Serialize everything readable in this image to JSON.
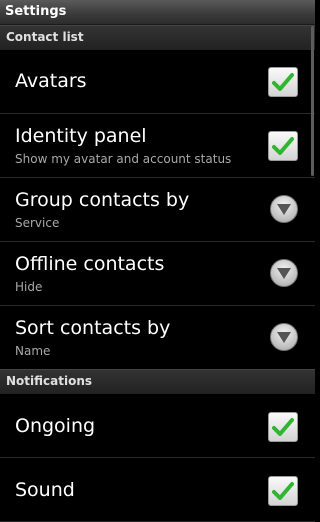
{
  "window": {
    "title": "Settings"
  },
  "sections": {
    "contact_list": "Contact list",
    "notifications": "Notifications"
  },
  "settings": {
    "avatars": {
      "title": "Avatars",
      "checked": true
    },
    "identity_panel": {
      "title": "Identity panel",
      "summary": "Show my avatar and account status",
      "checked": true
    },
    "group_contacts": {
      "title": "Group contacts by",
      "summary": "Service",
      "icon": "chevron-down-icon"
    },
    "offline_contacts": {
      "title": "Offline contacts",
      "summary": "Hide",
      "icon": "chevron-down-icon"
    },
    "sort_contacts": {
      "title": "Sort contacts by",
      "summary": "Name",
      "icon": "chevron-down-icon"
    },
    "ongoing": {
      "title": "Ongoing",
      "checked": true
    },
    "sound": {
      "title": "Sound",
      "checked": true
    }
  },
  "colors": {
    "check_green": "#2fb52f",
    "section_bg": "#2a2a2a"
  }
}
